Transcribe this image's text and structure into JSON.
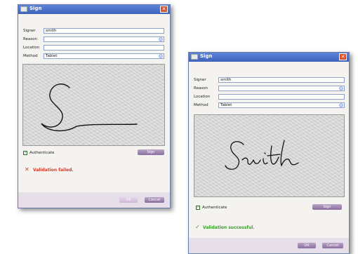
{
  "dialogs": [
    {
      "title": "Sign",
      "close_glyph": "✕",
      "labels": {
        "signer": "Signer",
        "reason": "Reason",
        "location": "Location",
        "method": "Method"
      },
      "signer_value": "smith",
      "reason_value": "",
      "location_value": "",
      "method_value": "Tablet",
      "authenticate_label": "Authenticate",
      "authenticate_checked": true,
      "sign_button": "Sign",
      "status_icon": "✕",
      "status_message": "Validation failed.",
      "ok_button": "OK",
      "cancel_button": "Cancel"
    },
    {
      "title": "Sign",
      "close_glyph": "✕",
      "labels": {
        "signer": "Signer",
        "reason": "Reason",
        "location": "Location",
        "method": "Method"
      },
      "signer_value": "smith",
      "reason_value": "",
      "location_value": "",
      "method_value": "Tablet",
      "authenticate_label": "Authenticate",
      "authenticate_checked": true,
      "sign_button": "Sign",
      "status_icon": "✓",
      "status_message": "Validation successful.",
      "ok_button": "OK",
      "cancel_button": "Cancel"
    }
  ],
  "colors": {
    "error": "#d63a2a",
    "success": "#3a9a2a",
    "titlebar": "#4a6fc8",
    "button": "#9a7fae"
  }
}
